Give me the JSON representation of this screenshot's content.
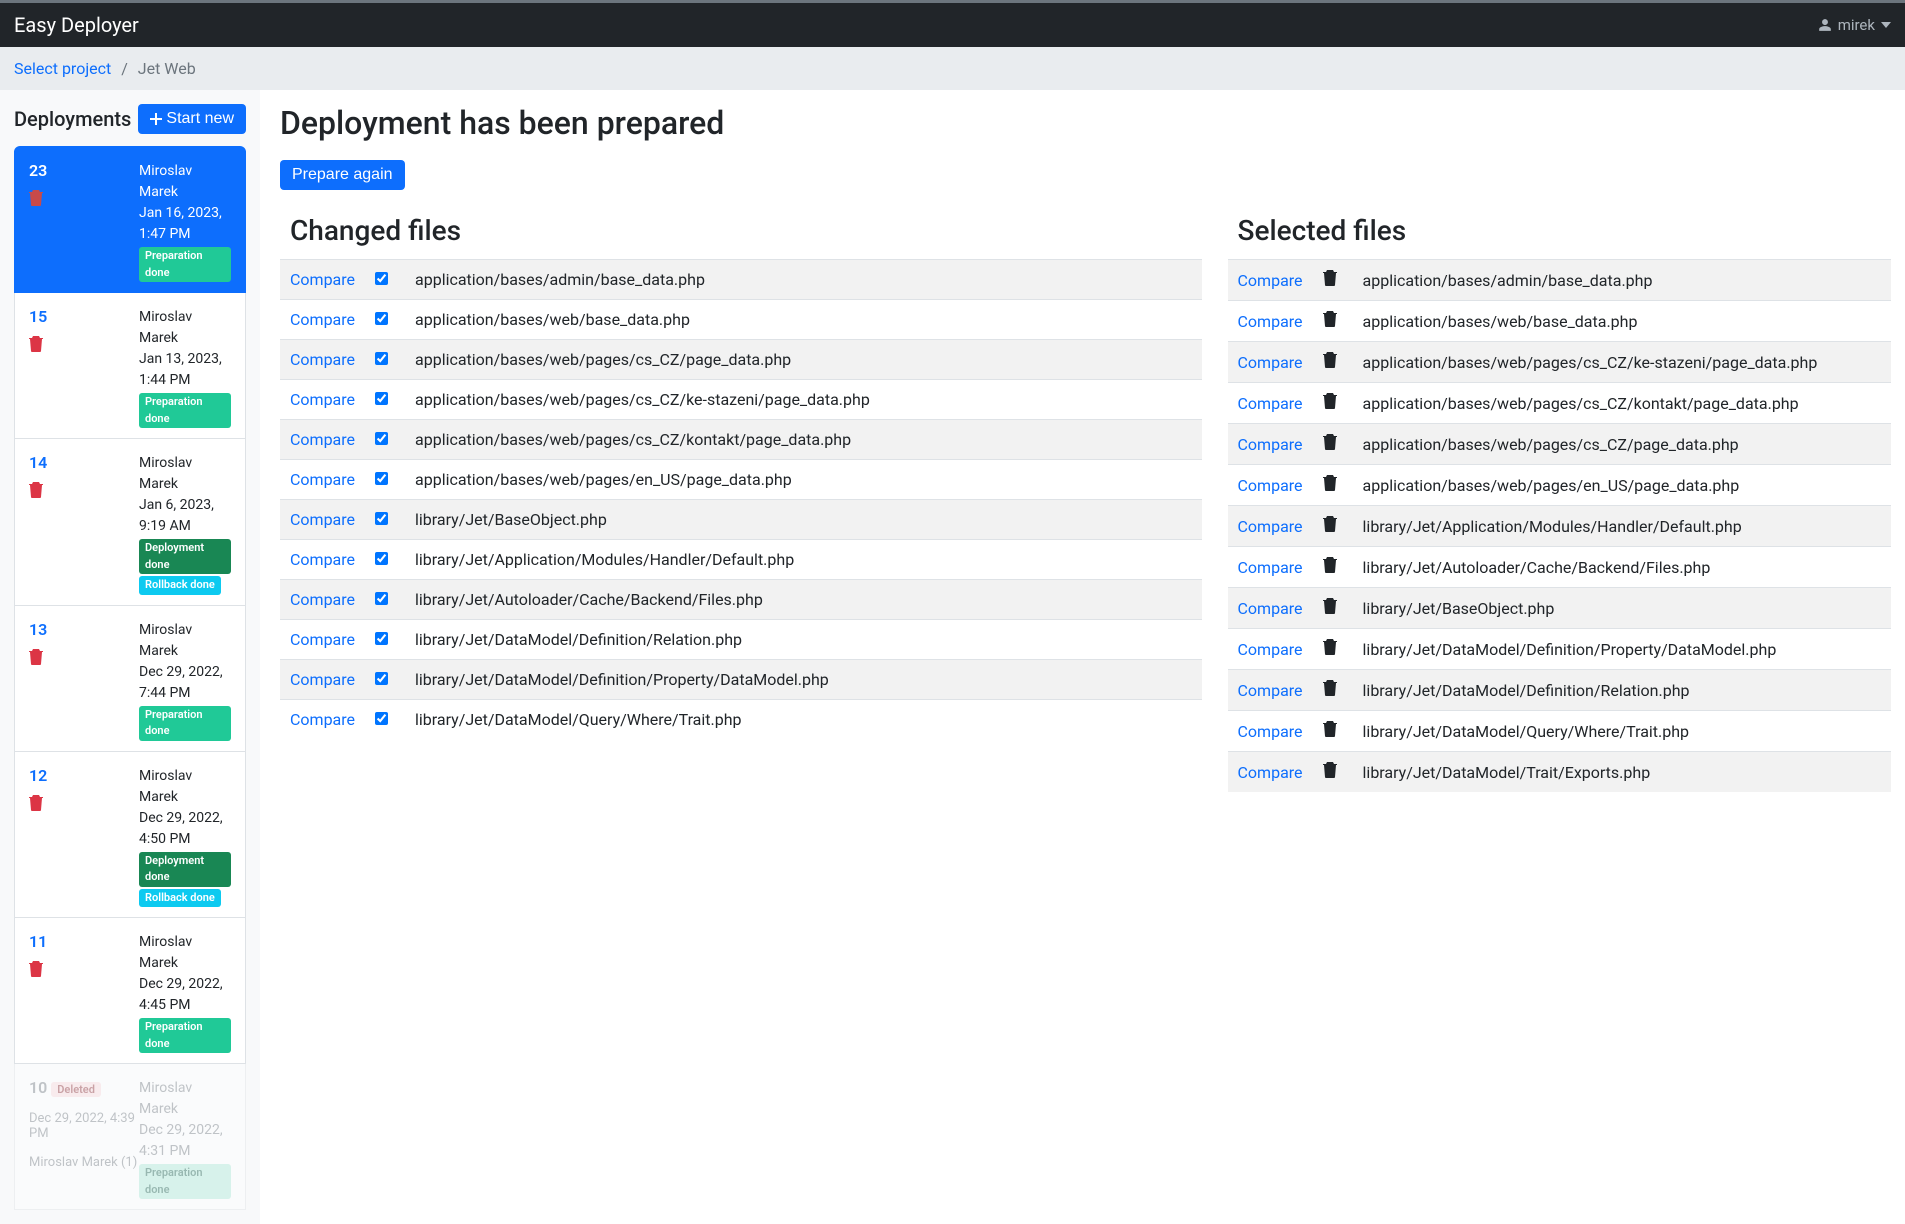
{
  "header": {
    "brand": "Easy Deployer",
    "user": "mirek"
  },
  "breadcrumb": {
    "link": "Select project",
    "current": "Jet Web"
  },
  "sidebar": {
    "title": "Deployments",
    "start_new": "Start new",
    "items": [
      {
        "num": "23",
        "author": "Miroslav Marek",
        "date": "Jan 16, 2023, 1:47 PM",
        "badges": [
          "prep"
        ],
        "active": true
      },
      {
        "num": "15",
        "author": "Miroslav Marek",
        "date": "Jan 13, 2023, 1:44 PM",
        "badges": [
          "prep"
        ]
      },
      {
        "num": "14",
        "author": "Miroslav Marek",
        "date": "Jan 6, 2023, 9:19 AM",
        "badges": [
          "deploy",
          "rollback"
        ]
      },
      {
        "num": "13",
        "author": "Miroslav Marek",
        "date": "Dec 29, 2022, 7:44 PM",
        "badges": [
          "prep"
        ]
      },
      {
        "num": "12",
        "author": "Miroslav Marek",
        "date": "Dec 29, 2022, 4:50 PM",
        "badges": [
          "deploy",
          "rollback"
        ]
      },
      {
        "num": "11",
        "author": "Miroslav Marek",
        "date": "Dec 29, 2022, 4:45 PM",
        "badges": [
          "prep"
        ]
      }
    ],
    "faded": {
      "num": "10",
      "deleted_label": "Deleted",
      "left_date": "Dec 29, 2022, 4:39 PM",
      "left_by": "Miroslav Marek (1)",
      "author": "Miroslav Marek",
      "date": "Dec 29, 2022, 4:31 PM",
      "badge": "Preparation done"
    }
  },
  "badge_labels": {
    "prep": "Preparation done",
    "deploy": "Deployment done",
    "rollback": "Rollback done"
  },
  "main": {
    "title": "Deployment has been prepared",
    "prepare_again": "Prepare again",
    "changed_title": "Changed files",
    "selected_title": "Selected files",
    "compare_label": "Compare",
    "changed_files": [
      "application/bases/admin/base_data.php",
      "application/bases/web/base_data.php",
      "application/bases/web/pages/cs_CZ/page_data.php",
      "application/bases/web/pages/cs_CZ/ke-stazeni/page_data.php",
      "application/bases/web/pages/cs_CZ/kontakt/page_data.php",
      "application/bases/web/pages/en_US/page_data.php",
      "library/Jet/BaseObject.php",
      "library/Jet/Application/Modules/Handler/Default.php",
      "library/Jet/Autoloader/Cache/Backend/Files.php",
      "library/Jet/DataModel/Definition/Relation.php",
      "library/Jet/DataModel/Definition/Property/DataModel.php",
      "library/Jet/DataModel/Query/Where/Trait.php"
    ],
    "selected_files": [
      "application/bases/admin/base_data.php",
      "application/bases/web/base_data.php",
      "application/bases/web/pages/cs_CZ/ke-stazeni/page_data.php",
      "application/bases/web/pages/cs_CZ/kontakt/page_data.php",
      "application/bases/web/pages/cs_CZ/page_data.php",
      "application/bases/web/pages/en_US/page_data.php",
      "library/Jet/Application/Modules/Handler/Default.php",
      "library/Jet/Autoloader/Cache/Backend/Files.php",
      "library/Jet/BaseObject.php",
      "library/Jet/DataModel/Definition/Property/DataModel.php",
      "library/Jet/DataModel/Definition/Relation.php",
      "library/Jet/DataModel/Query/Where/Trait.php",
      "library/Jet/DataModel/Trait/Exports.php"
    ]
  }
}
